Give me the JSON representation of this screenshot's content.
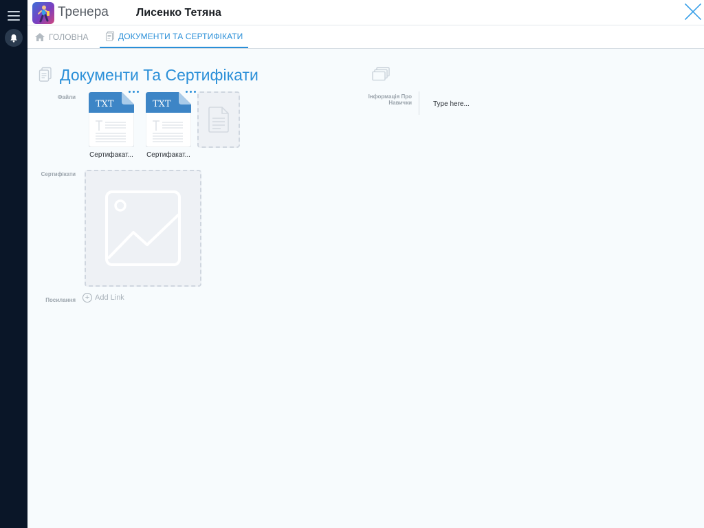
{
  "app": {
    "title": "Тренера",
    "person_name": "Лисенко Тетяна"
  },
  "tabs": [
    {
      "label": "ГОЛОВНА",
      "icon": "home-icon",
      "active": false
    },
    {
      "label": "ДОКУМЕНТИ ТА СЕРТИФІКАТИ",
      "icon": "documents-icon",
      "active": true
    }
  ],
  "section": {
    "title": "Документи Та Сертифікати"
  },
  "fields": {
    "files_label": "Файли",
    "certificates_label": "Сертифікати",
    "links_label": "Посилання",
    "add_link_label": "Add Link",
    "skills_label": "Інформація Про Навички",
    "skills_placeholder": "Type here..."
  },
  "files": [
    {
      "type_badge": "TXT",
      "name": "Сертифакат..."
    },
    {
      "type_badge": "TXT",
      "name": "Сертифакат..."
    }
  ],
  "colors": {
    "accent": "#2a8fd8",
    "sidebar": "#0a1628",
    "file_blue": "#3d85c6"
  }
}
